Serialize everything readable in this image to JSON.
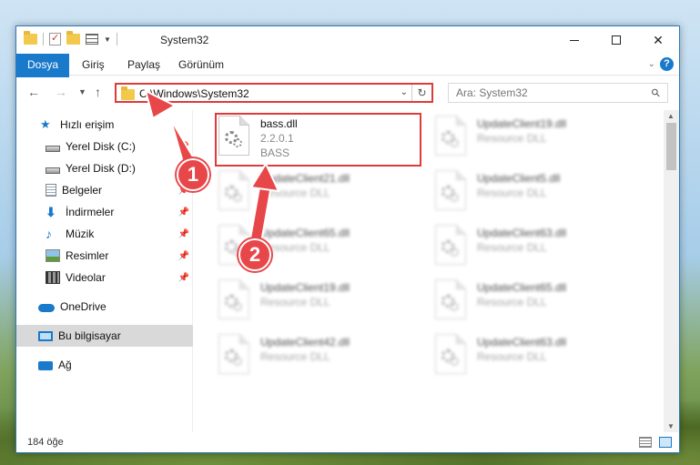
{
  "window": {
    "title": "System32",
    "minimize_symbol": "",
    "close_symbol": "✕"
  },
  "ribbon": {
    "tabs": [
      "Dosya",
      "Giriş",
      "Paylaş",
      "Görünüm"
    ],
    "help_symbol": "?"
  },
  "address": {
    "path": "C:\\Windows\\System32",
    "search_placeholder": "Ara: System32"
  },
  "sidebar": {
    "items": [
      {
        "label": "Hızlı erişim",
        "icon": "star-icon"
      },
      {
        "label": "Yerel Disk (C:)",
        "icon": "drive-icon"
      },
      {
        "label": "Yerel Disk (D:)",
        "icon": "drive-icon"
      },
      {
        "label": "Belgeler",
        "icon": "documents-icon"
      },
      {
        "label": "İndirmeler",
        "icon": "download-icon"
      },
      {
        "label": "Müzik",
        "icon": "music-icon"
      },
      {
        "label": "Resimler",
        "icon": "pictures-icon"
      },
      {
        "label": "Videolar",
        "icon": "videos-icon"
      },
      {
        "label": "OneDrive",
        "icon": "cloud-icon"
      },
      {
        "label": "Bu bilgisayar",
        "icon": "computer-icon"
      },
      {
        "label": "Ağ",
        "icon": "network-icon"
      }
    ]
  },
  "files": [
    {
      "name": "bass.dll",
      "line1": "2.2.0.1",
      "line2": "BASS"
    },
    {
      "name": "UpdateClient19.dll",
      "line1": "Resource DLL",
      "line2": ""
    },
    {
      "name": "UpdateClient21.dll",
      "line1": "Resource DLL",
      "line2": ""
    },
    {
      "name": "UpdateClient5.dll",
      "line1": "Resource DLL",
      "line2": ""
    },
    {
      "name": "UpdateClient65.dll",
      "line1": "Resource DLL",
      "line2": ""
    },
    {
      "name": "UpdateClient63.dll",
      "line1": "Resource DLL",
      "line2": ""
    },
    {
      "name": "UpdateClient19.dll",
      "line1": "Resource DLL",
      "line2": ""
    },
    {
      "name": "UpdateClient65.dll",
      "line1": "Resource DLL",
      "line2": ""
    },
    {
      "name": "UpdateClient42.dll",
      "line1": "Resource DLL",
      "line2": ""
    },
    {
      "name": "UpdateClient63.dll",
      "line1": "Resource DLL",
      "line2": ""
    }
  ],
  "status": {
    "count": "184 öğe"
  },
  "annotations": {
    "step1": "1",
    "step2": "2"
  },
  "colors": {
    "accent": "#1979ca",
    "highlight": "#e03a3a"
  }
}
